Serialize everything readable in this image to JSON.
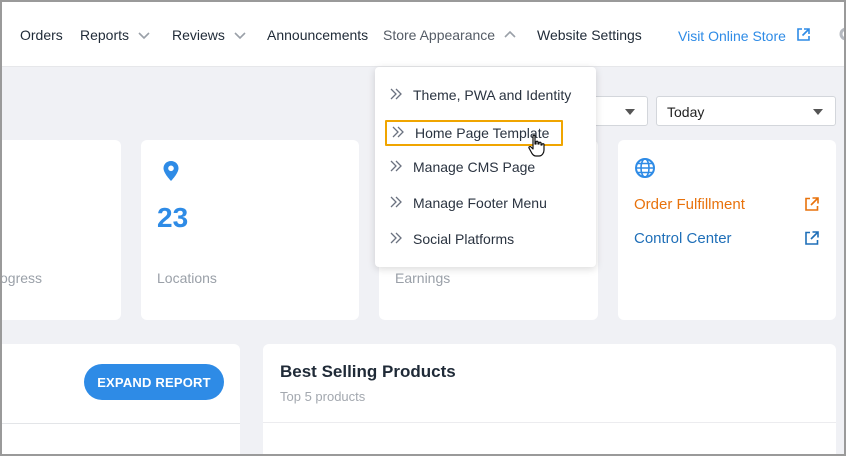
{
  "nav": {
    "orders": "Orders",
    "reports": "Reports",
    "reviews": "Reviews",
    "announcements": "Announcements",
    "store_appearance": "Store Appearance",
    "website_settings": "Website Settings",
    "visit_store": "Visit Online Store"
  },
  "store_appearance_menu": {
    "items": [
      {
        "label": "Theme, PWA and Identity"
      },
      {
        "label": "Home Page Template"
      },
      {
        "label": "Manage CMS Page"
      },
      {
        "label": "Manage Footer Menu"
      },
      {
        "label": "Social Platforms"
      }
    ]
  },
  "filters": {
    "date_range_value": "Today"
  },
  "cards": {
    "in_progress_label": "ogress",
    "locations_count": "23",
    "locations_label": "Locations",
    "earnings_label": "Earnings",
    "order_fulfillment": "Order Fulfillment",
    "control_center": "Control Center"
  },
  "panels": {
    "expand_report": "EXPAND REPORT",
    "best_selling_title": "Best Selling Products",
    "best_selling_subtitle": "Top 5 products"
  },
  "colors": {
    "accent": "#2e8be6",
    "fulfillment": "#e8720c",
    "highlight": "#f0a500"
  },
  "icons": [
    "chevron-down-icon",
    "chevron-up-icon",
    "external-link-icon",
    "gear-icon",
    "location-pin-icon",
    "globe-icon",
    "double-chevron-right-icon",
    "hand-pointer-icon"
  ]
}
